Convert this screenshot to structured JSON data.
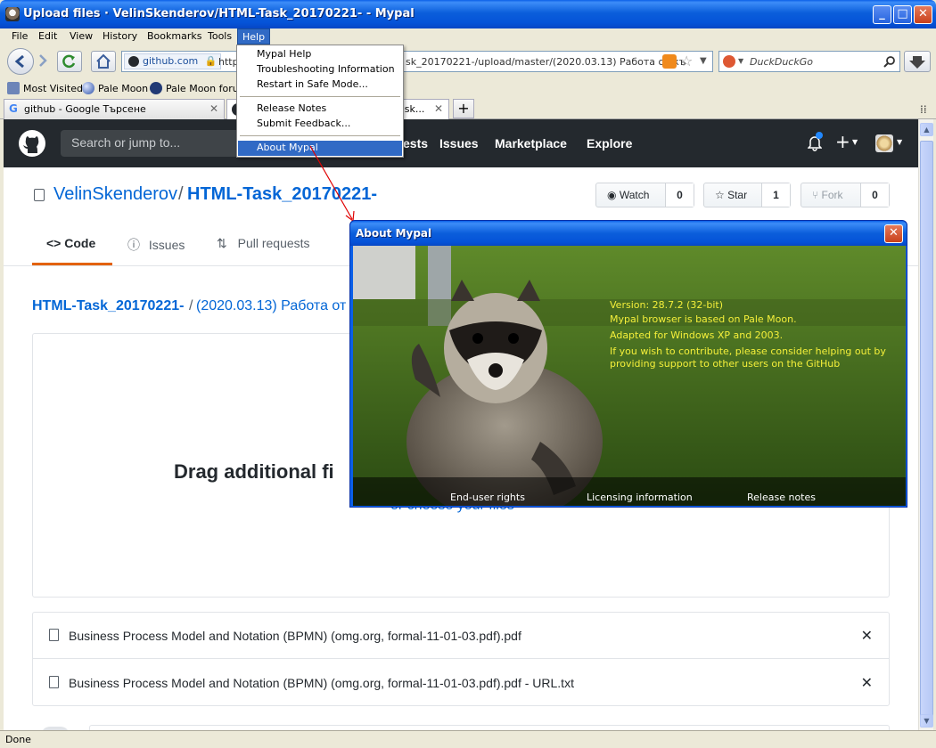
{
  "window": {
    "title": "Upload files · VelinSkenderov/HTML-Task_20170221- - Mypal"
  },
  "menubar": {
    "items": [
      {
        "id": "file",
        "label": "File"
      },
      {
        "id": "edit",
        "label": "Edit"
      },
      {
        "id": "view",
        "label": "View"
      },
      {
        "id": "history",
        "label": "History"
      },
      {
        "id": "bookmarks",
        "label": "Bookmarks"
      },
      {
        "id": "tools",
        "label": "Tools"
      },
      {
        "id": "help",
        "label": "Help"
      }
    ]
  },
  "navbar": {
    "identity": "github.com",
    "url_prefix": "https",
    "url_suffix": "sk_20170221-/upload/master/(2020.03.13) Работа от къ",
    "search_engine": "DuckDuckGo"
  },
  "bookmarks": {
    "items": [
      {
        "label": "Most Visited"
      },
      {
        "label": "Pale Moon"
      },
      {
        "label": "Pale Moon forum"
      }
    ]
  },
  "tabs": [
    {
      "label": "github - Google Търсене"
    },
    {
      "label": "ask..."
    }
  ],
  "help_menu": {
    "items": [
      "Mypal Help",
      "Troubleshooting Information",
      "Restart in Safe Mode...",
      "Release Notes",
      "Submit Feedback...",
      "About Mypal"
    ]
  },
  "github": {
    "search_placeholder": "Search or jump to...",
    "nav": {
      "pulls_partial": "ests",
      "issues": "Issues",
      "marketplace": "Marketplace",
      "explore": "Explore"
    },
    "repo": {
      "owner": "VelinSkenderov",
      "sep": "/",
      "name": "HTML-Task_20170221-"
    },
    "buttons": {
      "watch": {
        "label": "Watch",
        "count": "0"
      },
      "star": {
        "label": "Star",
        "count": "1"
      },
      "fork": {
        "label": "Fork",
        "count": "0"
      }
    },
    "repo_nav": {
      "code": "Code",
      "issues": "Issues",
      "pulls": "Pull requests"
    },
    "breadcrumb": {
      "repo": "HTML-Task_20170221-",
      "sep": "/",
      "path": "(2020.03.13) Работа от"
    },
    "drag_text": "Drag additional fi",
    "choose_text": "or choose your files",
    "files": [
      {
        "name": "Business Process Model and Notation (BPMN) (omg.org, formal-11-01-03.pdf).pdf"
      },
      {
        "name": "Business Process Model and Notation (BPMN) (omg.org, formal-11-01-03.pdf).pdf - URL.txt"
      }
    ]
  },
  "about_dialog": {
    "title": "About Mypal",
    "lines": [
      "Version: 28.7.2 (32-bit)",
      "Mypal browser is based on Pale Moon.",
      "Adapted for Windows XP and 2003.",
      "If you wish to contribute, please consider helping out by",
      "providing support to other users on the GitHub"
    ],
    "links": {
      "eula": "End-user rights",
      "licensing": "Licensing information",
      "release": "Release notes"
    }
  },
  "statusbar": {
    "text": "Done"
  },
  "colors": {
    "xp_blue": "#0A5FE8",
    "github_dark": "#24292e",
    "github_link": "#0366d6",
    "about_text": "#f4ef3a"
  }
}
